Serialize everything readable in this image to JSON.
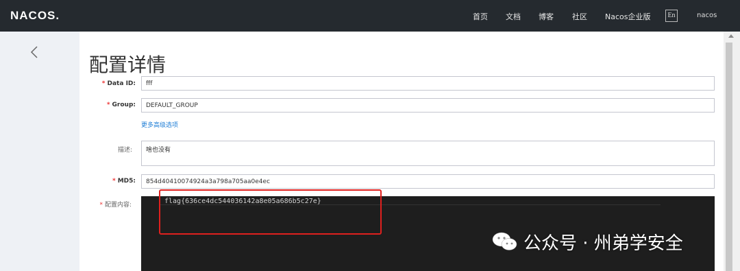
{
  "header": {
    "logo": "NACOS",
    "nav": [
      "首页",
      "文档",
      "博客",
      "社区",
      "Nacos企业版"
    ],
    "lang": "En",
    "user": "nacos"
  },
  "page": {
    "title": "配置详情"
  },
  "form": {
    "data_id_label": "Data ID:",
    "data_id_value": "fff",
    "group_label": "Group:",
    "group_value": "DEFAULT_GROUP",
    "advanced_link": "更多高级选项",
    "desc_label": "描述:",
    "desc_value": "啥也没有",
    "md5_label": "MD5:",
    "md5_value": "854d40410074924a3a798a705aa0e4ec",
    "content_label": "配置内容:",
    "content_value": "flag{636ce4dc544036142a8e05a686b5c27e}"
  },
  "watermark": {
    "text": "公众号 · 州弟学安全"
  },
  "colors": {
    "header_bg": "#252a2f",
    "sidebar_bg": "#eef1f5",
    "editor_bg": "#1e1e1e",
    "highlight_box": "#e0201e",
    "link": "#1f7ed6",
    "required": "#e33"
  }
}
